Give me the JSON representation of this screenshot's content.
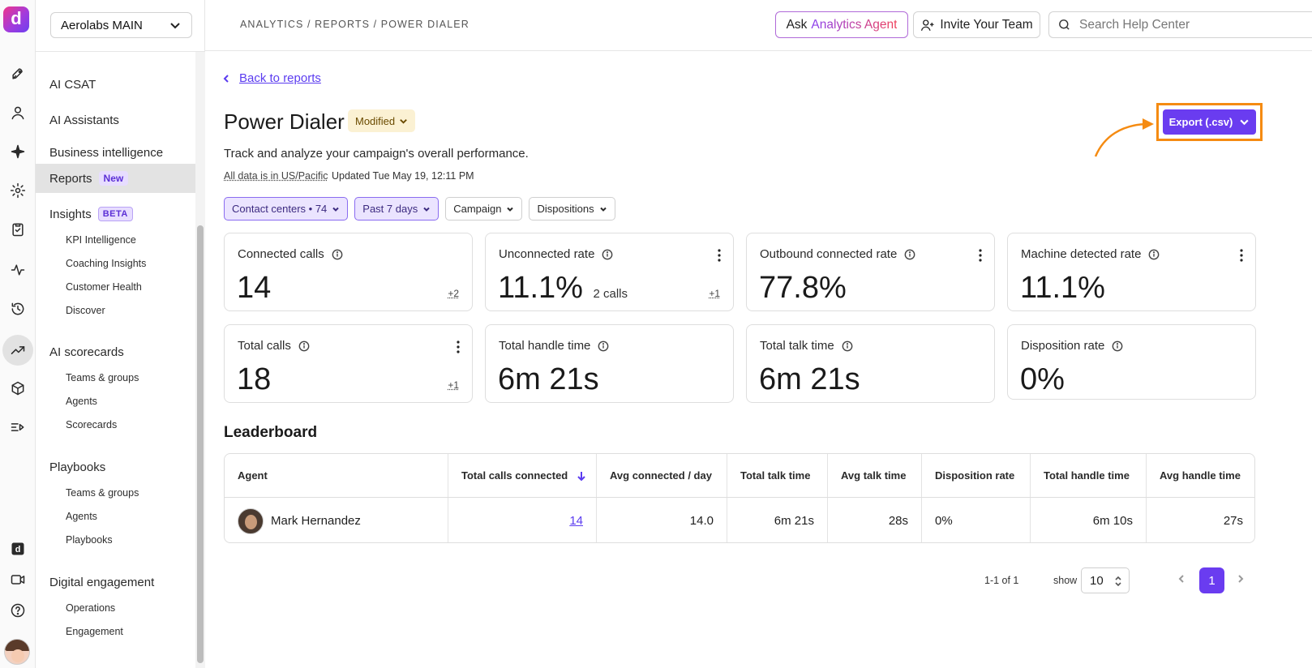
{
  "workspace": "Aerolabs MAIN",
  "breadcrumb": "ANALYTICS / REPORTS / POWER DIALER",
  "topbar": {
    "ask_prefix": "Ask",
    "ask_agent": "Analytics Agent",
    "invite_label": "Invite Your Team",
    "search_placeholder": "Search Help Center"
  },
  "rail_icons": [
    "rocket-icon",
    "person-icon",
    "sparkle-icon",
    "gear-icon",
    "clipboard-icon",
    "activity-icon",
    "history-icon",
    "trending-icon",
    "cube-icon",
    "sequence-icon",
    "dialpad-icon",
    "video-icon",
    "help-icon"
  ],
  "nav": {
    "items": [
      {
        "label": "AI CSAT"
      },
      {
        "label": "AI Assistants"
      },
      {
        "label": "Business intelligence"
      },
      {
        "label": "Reports",
        "badge": "New"
      },
      {
        "label": "Insights",
        "badge": "BETA"
      },
      {
        "label": "KPI Intelligence"
      },
      {
        "label": "Coaching Insights"
      },
      {
        "label": "Customer Health"
      },
      {
        "label": "Discover"
      },
      {
        "label": "AI scorecards"
      },
      {
        "label": "Teams & groups"
      },
      {
        "label": "Agents"
      },
      {
        "label": "Scorecards"
      },
      {
        "label": "Playbooks"
      },
      {
        "label": "Teams & groups"
      },
      {
        "label": "Agents"
      },
      {
        "label": "Playbooks"
      },
      {
        "label": "Digital engagement"
      },
      {
        "label": "Operations"
      },
      {
        "label": "Engagement"
      }
    ]
  },
  "page": {
    "back_label": "Back to reports",
    "title": "Power Dialer",
    "status_badge": "Modified",
    "description": "Track and analyze your campaign's overall performance.",
    "timezone_note": "All data is in US/Pacific",
    "updated": "Updated Tue May 19, 12:11 PM",
    "export_label": "Export (.csv)"
  },
  "filters": [
    {
      "label": "Contact centers • 74"
    },
    {
      "label": "Past 7 days"
    },
    {
      "label": "Campaign"
    },
    {
      "label": "Dispositions"
    }
  ],
  "metrics": [
    {
      "label": "Connected calls",
      "value": "14",
      "delta": "+2"
    },
    {
      "label": "Unconnected rate",
      "value": "11.1%",
      "sub": "2 calls",
      "delta": "+1"
    },
    {
      "label": "Outbound connected rate",
      "value": "77.8%"
    },
    {
      "label": "Machine detected rate",
      "value": "11.1%"
    },
    {
      "label": "Total calls",
      "value": "18",
      "delta": "+1"
    },
    {
      "label": "Total handle time",
      "value": "6m 21s"
    },
    {
      "label": "Total talk time",
      "value": "6m 21s"
    },
    {
      "label": "Disposition rate",
      "value": "0%"
    }
  ],
  "leaderboard": {
    "title": "Leaderboard",
    "columns": [
      "Agent",
      "Total calls connected",
      "Avg connected / day",
      "Total talk time",
      "Avg talk time",
      "Disposition rate",
      "Total handle time",
      "Avg handle time"
    ],
    "rows": [
      [
        "Mark Hernandez",
        "14",
        "14.0",
        "6m 21s",
        "28s",
        "0%",
        "6m 10s",
        "27s"
      ]
    ]
  },
  "pagination": {
    "range": "1-1 of 1",
    "show_label": "show",
    "page_size": "10",
    "current_page": "1"
  },
  "colors": {
    "accent": "#6a3cf0",
    "highlight": "#f58b12"
  }
}
